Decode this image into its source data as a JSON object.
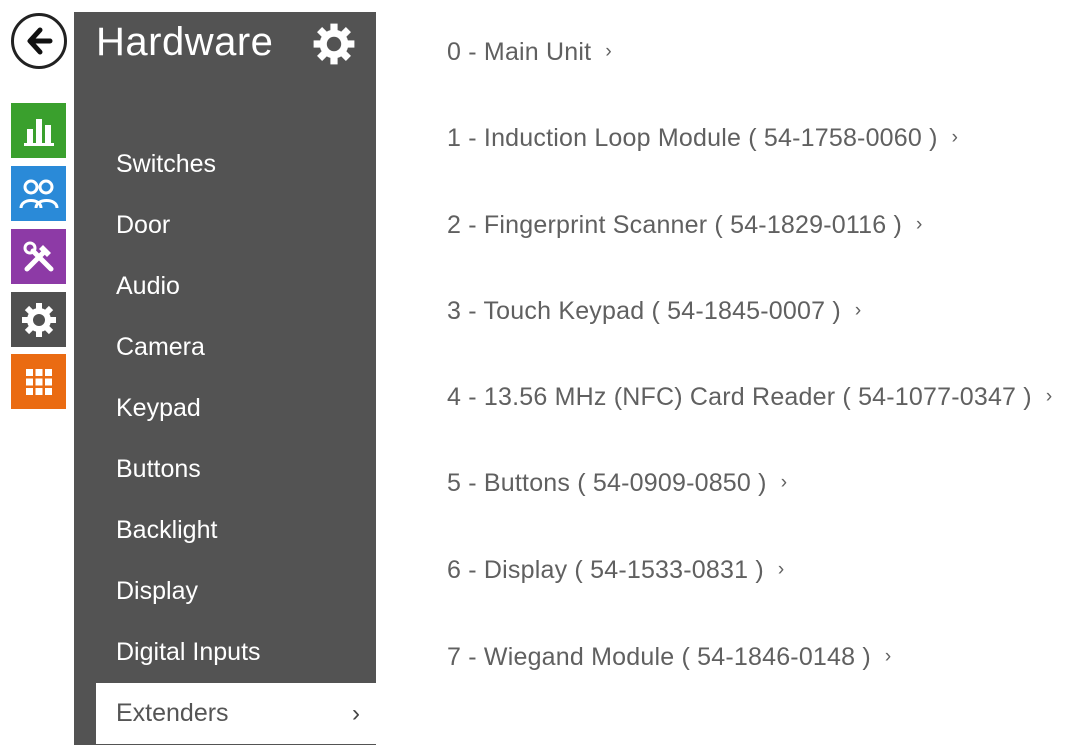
{
  "colors": {
    "sidebar_bg": "#535353",
    "tile_green": "#3aa02d",
    "tile_blue": "#2a8ad8",
    "tile_purple": "#8d3aa6",
    "tile_dark": "#505050",
    "tile_orange": "#ea6b12",
    "text_gray": "#606060"
  },
  "rail": {
    "back": {
      "icon": "arrow-left-icon"
    },
    "tiles": [
      {
        "icon": "status-chart-icon"
      },
      {
        "icon": "directory-users-icon"
      },
      {
        "icon": "services-tools-icon"
      },
      {
        "icon": "hardware-gear-icon"
      },
      {
        "icon": "system-grid-icon"
      }
    ]
  },
  "sidebar": {
    "title": "Hardware",
    "settings_icon": "gear-icon",
    "items": [
      {
        "label": "Switches"
      },
      {
        "label": "Door"
      },
      {
        "label": "Audio"
      },
      {
        "label": "Camera"
      },
      {
        "label": "Keypad"
      },
      {
        "label": "Buttons"
      },
      {
        "label": "Backlight"
      },
      {
        "label": "Display"
      },
      {
        "label": "Digital Inputs"
      },
      {
        "label": "Extenders",
        "active": true,
        "chevron": "›"
      }
    ]
  },
  "main": {
    "items": [
      {
        "label": "0 - Main Unit",
        "arrow": "›"
      },
      {
        "label": "1 - Induction Loop Module ( 54-1758-0060 )",
        "arrow": "›"
      },
      {
        "label": "2 - Fingerprint Scanner ( 54-1829-0116 )",
        "arrow": "›"
      },
      {
        "label": "3 - Touch Keypad ( 54-1845-0007 )",
        "arrow": "›"
      },
      {
        "label": "4 - 13.56 MHz (NFC) Card Reader ( 54-1077-0347 )",
        "arrow": "›"
      },
      {
        "label": "5 - Buttons ( 54-0909-0850 )",
        "arrow": "›"
      },
      {
        "label": "6 - Display ( 54-1533-0831 )",
        "arrow": "›"
      },
      {
        "label": "7 - Wiegand Module ( 54-1846-0148 )",
        "arrow": "›"
      }
    ]
  }
}
